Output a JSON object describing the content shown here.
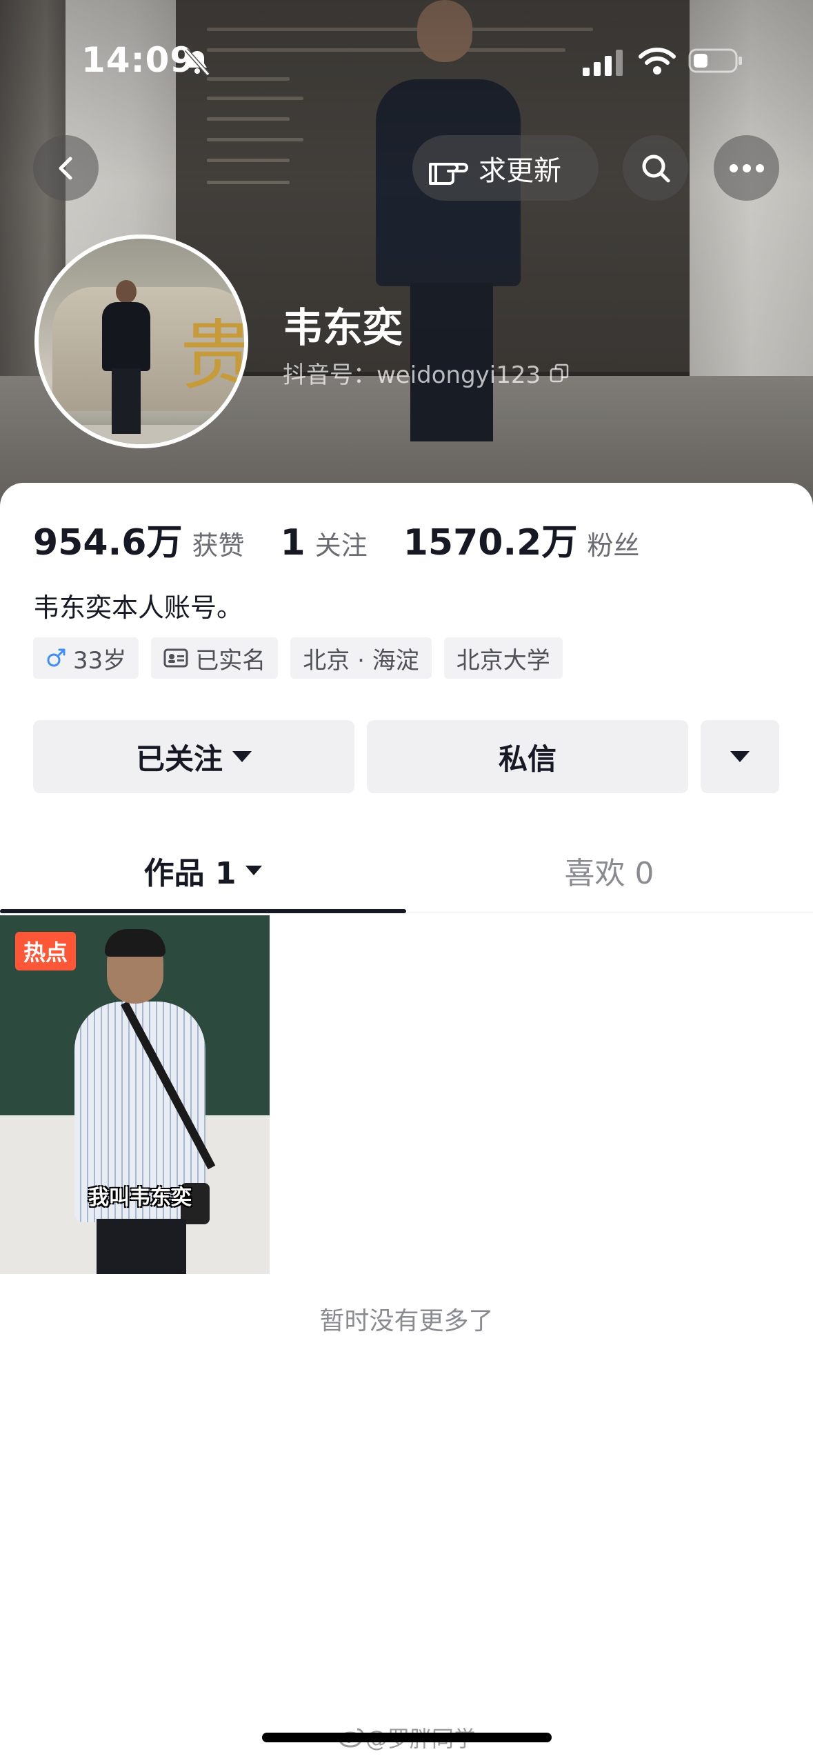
{
  "status_bar": {
    "time": "14:09"
  },
  "nav": {
    "update_label": "求更新"
  },
  "profile": {
    "nickname": "韦东奕",
    "douyin_id": "抖音号：weidongyi123",
    "bio": "韦东奕本人账号。"
  },
  "stats": [
    {
      "value": "954.6万",
      "label": "获赞"
    },
    {
      "value": "1",
      "label": "关注"
    },
    {
      "value": "1570.2万",
      "label": "粉丝"
    }
  ],
  "tags": {
    "gender_age": "33岁",
    "verified": "已实名",
    "location": "北京 · 海淀",
    "school": "北京大学"
  },
  "actions": {
    "follow_label": "已关注",
    "message_label": "私信"
  },
  "tabs": {
    "works": "作品 1",
    "likes": "喜欢 0"
  },
  "video": {
    "badge": "热点",
    "caption": "我叫韦东奕"
  },
  "footer": {
    "no_more": "暂时没有更多了",
    "watermark": "@罗胖同学"
  },
  "colors": {
    "hot_badge": "#fe5737",
    "text_primary": "#161823",
    "text_secondary": "#6b6c73",
    "button_bg": "#f0f0f2",
    "gender_icon": "#3d8ef7"
  }
}
